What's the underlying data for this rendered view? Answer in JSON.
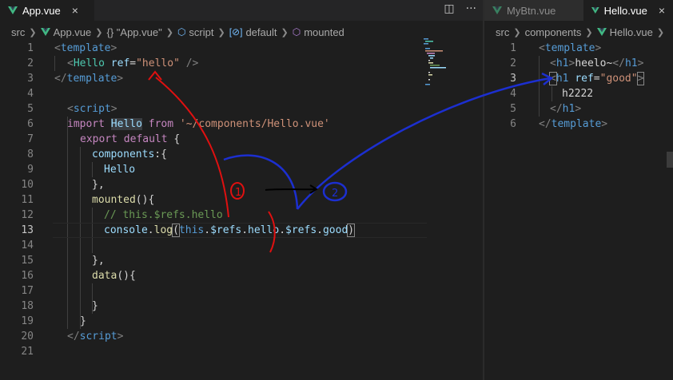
{
  "left": {
    "tabs": [
      {
        "label": "App.vue",
        "close": "×"
      }
    ],
    "actions": [
      {
        "icon": "split-editor-icon",
        "glyph": "◫"
      },
      {
        "icon": "more-actions-icon",
        "glyph": "···"
      }
    ],
    "breadcrumb": [
      "src",
      "App.vue",
      "{} \"App.vue\"",
      "script",
      "default",
      "mounted"
    ],
    "lines": [
      {
        "n": "1"
      },
      {
        "n": "2"
      },
      {
        "n": "3"
      },
      {
        "n": "4"
      },
      {
        "n": "5"
      },
      {
        "n": "6"
      },
      {
        "n": "7"
      },
      {
        "n": "8"
      },
      {
        "n": "9"
      },
      {
        "n": "10"
      },
      {
        "n": "11"
      },
      {
        "n": "12"
      },
      {
        "n": "13"
      },
      {
        "n": "14"
      },
      {
        "n": "15"
      },
      {
        "n": "16"
      },
      {
        "n": "17"
      },
      {
        "n": "18"
      },
      {
        "n": "19"
      },
      {
        "n": "20"
      },
      {
        "n": "21"
      }
    ],
    "code": {
      "l1_open": "<",
      "l1_tag": "template",
      "l1_close": ">",
      "l2_open": "<",
      "l2_comp": "Hello",
      "l2_attr": "ref",
      "l2_eq": "=",
      "l2_str": "\"hello\"",
      "l2_end": " />",
      "l3_open": "</",
      "l3_tag": "template",
      "l3_close": ">",
      "l5_open": "<",
      "l5_tag": "script",
      "l5_close": ">",
      "l6_import": "import",
      "l6_name": "Hello",
      "l6_from": "from",
      "l6_path": "'~/components/Hello.vue'",
      "l7_export": "export",
      "l7_default": "default",
      "l7_brace": " {",
      "l8_key": "components",
      "l8_rest": ":{",
      "l9_val": "Hello",
      "l10": "},",
      "l11_fn": "mounted",
      "l11_rest": "(){",
      "l12_cmt": "// this.$refs.hello",
      "l13_obj": "console",
      "l13_dot": ".",
      "l13_fn": "log",
      "l13_p1": "(",
      "l13_this": "this",
      "l13_d1": ".",
      "l13_refs1": "$refs",
      "l13_d2": ".",
      "l13_hello": "hello",
      "l13_d3": ".",
      "l13_refs2": "$refs",
      "l13_d4": ".",
      "l13_good": "good",
      "l13_p2": ")",
      "l15": "},",
      "l16_fn": "data",
      "l16_rest": "(){",
      "l18": "}",
      "l19": "}",
      "l20_open": "</",
      "l20_tag": "script",
      "l20_close": ">"
    }
  },
  "right": {
    "tabs": [
      {
        "label": "MyBtn.vue"
      },
      {
        "label": "Hello.vue",
        "close": "×"
      }
    ],
    "breadcrumb": [
      "src",
      "components",
      "Hello.vue"
    ],
    "lines": [
      {
        "n": "1"
      },
      {
        "n": "2"
      },
      {
        "n": "3"
      },
      {
        "n": "4"
      },
      {
        "n": "5"
      },
      {
        "n": "6"
      }
    ],
    "code": {
      "l1_open": "<",
      "l1_tag": "template",
      "l1_close": ">",
      "l2_open": "<",
      "l2_tag": "h1",
      "l2_close": ">",
      "l2_text": "heelo~",
      "l2_end_open": "</",
      "l2_end_tag": "h1",
      "l2_end_close": ">",
      "l3_open": "<",
      "l3_tag": "h1",
      "l3_attr": "ref",
      "l3_eq": "=",
      "l3_str": "\"good\"",
      "l3_close": ">",
      "l4_text": "h2222",
      "l5_open": "</",
      "l5_tag": "h1",
      "l5_close": ">",
      "l6_open": "</",
      "l6_tag": "template",
      "l6_close": ">"
    }
  },
  "annotations": {
    "red_label": "1",
    "blue_label": "2",
    "colors": {
      "red": "#e01010",
      "blue": "#1c2fd0",
      "black": "#000000"
    }
  },
  "colors": {
    "editor_bg": "#1e1e1e",
    "tabbar_bg": "#252526",
    "tag": "#569cd6",
    "component": "#4ec9b0",
    "attribute": "#9cdcfe",
    "string": "#ce9178",
    "keyword": "#c586c0",
    "function": "#dcdcaa",
    "comment": "#6a9955",
    "vue_green": "#41b883"
  }
}
